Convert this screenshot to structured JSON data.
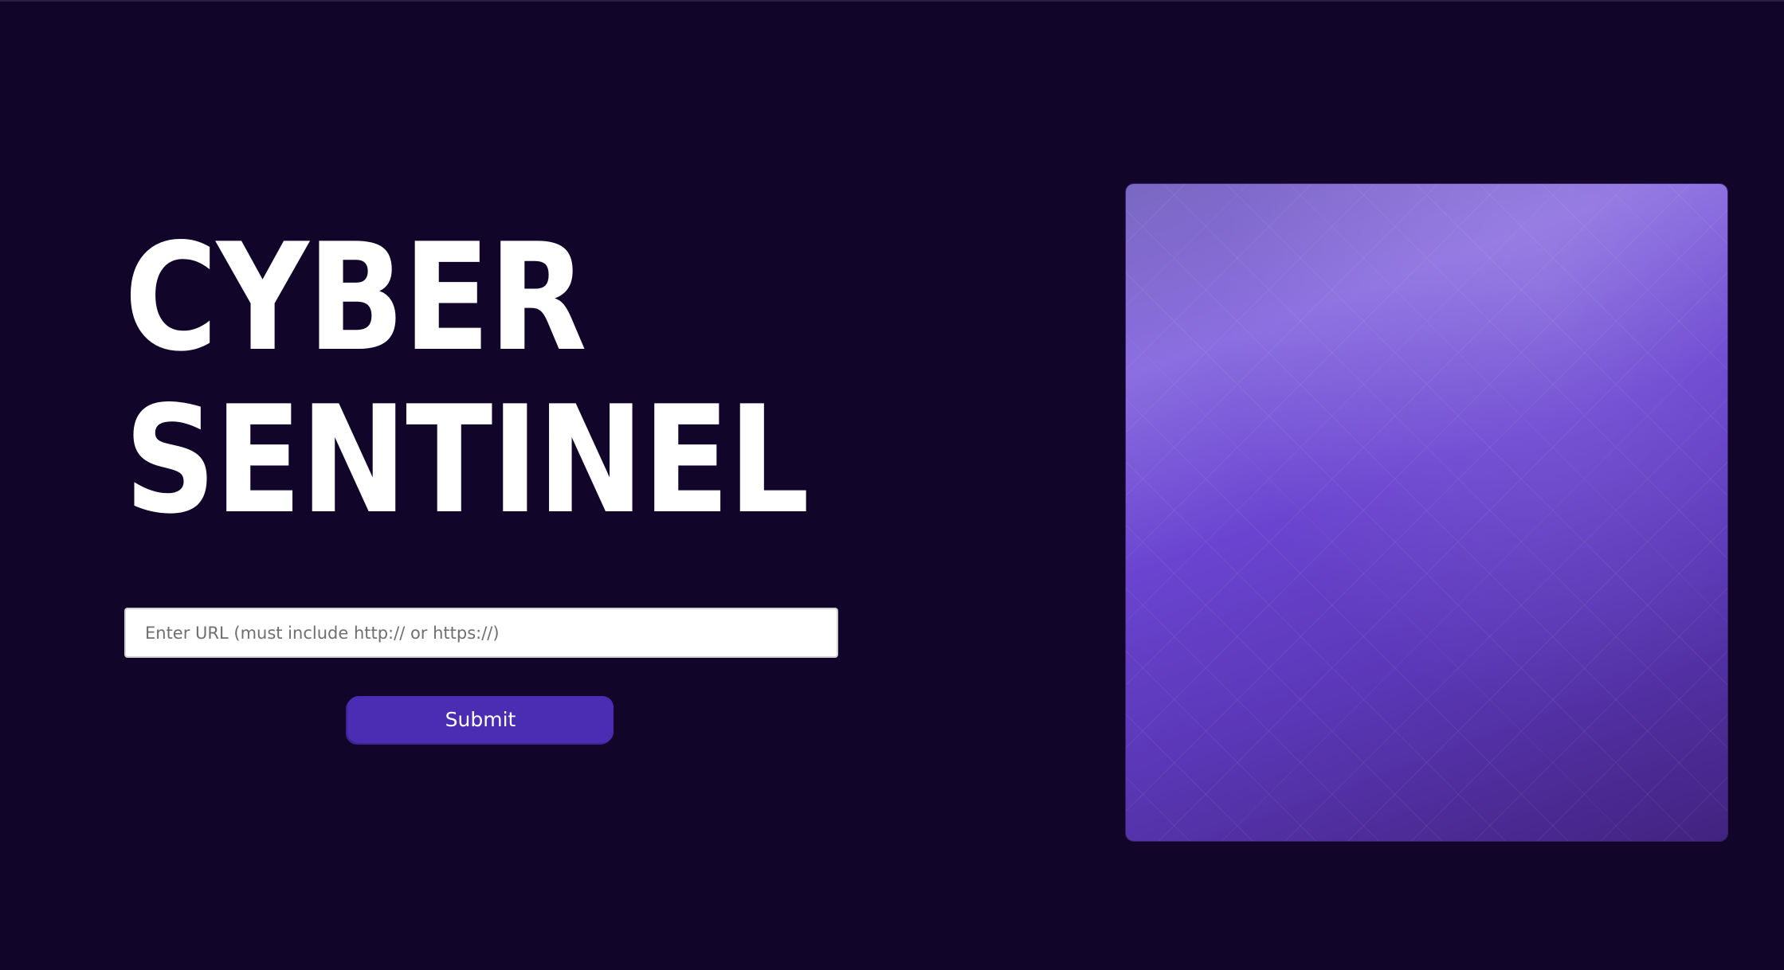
{
  "hero": {
    "title_line1": "CYBER",
    "title_line2": "SENTINEL"
  },
  "form": {
    "url_placeholder": "Enter URL (must include http:// or https://)",
    "url_value": "",
    "submit_label": "Submit"
  },
  "theme": {
    "background": "#12052a",
    "button": "#4a2db2",
    "panel_accent": "#6a44d0"
  }
}
